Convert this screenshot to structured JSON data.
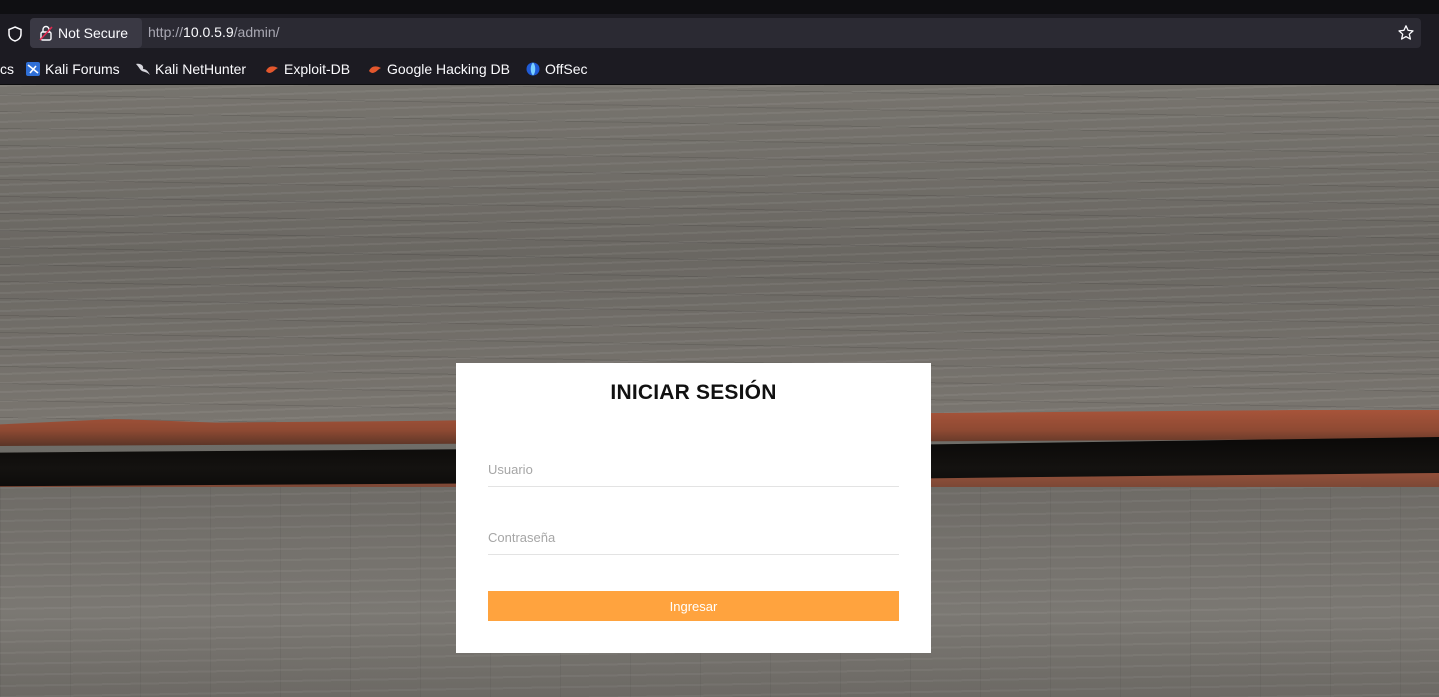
{
  "browser": {
    "security_label": "Not Secure",
    "url_scheme": "http://",
    "url_host": "10.0.5.9",
    "url_path": "/admin/",
    "bookmarks": [
      {
        "label": "cs",
        "icon": "none"
      },
      {
        "label": "Kali Forums",
        "icon": "kali-forums-icon"
      },
      {
        "label": "Kali NetHunter",
        "icon": "kali-dragon-icon"
      },
      {
        "label": "Exploit-DB",
        "icon": "exploit-db-icon"
      },
      {
        "label": "Google Hacking DB",
        "icon": "exploit-db-icon"
      },
      {
        "label": "OffSec",
        "icon": "offsec-icon"
      }
    ]
  },
  "login": {
    "title": "INICIAR SESIÓN",
    "username_placeholder": "Usuario",
    "password_placeholder": "Contraseña",
    "submit_label": "Ingresar"
  },
  "colors": {
    "accent": "#ffa33e",
    "browser_bg": "#1c1b22",
    "urlbar_bg": "#2b2a33"
  }
}
